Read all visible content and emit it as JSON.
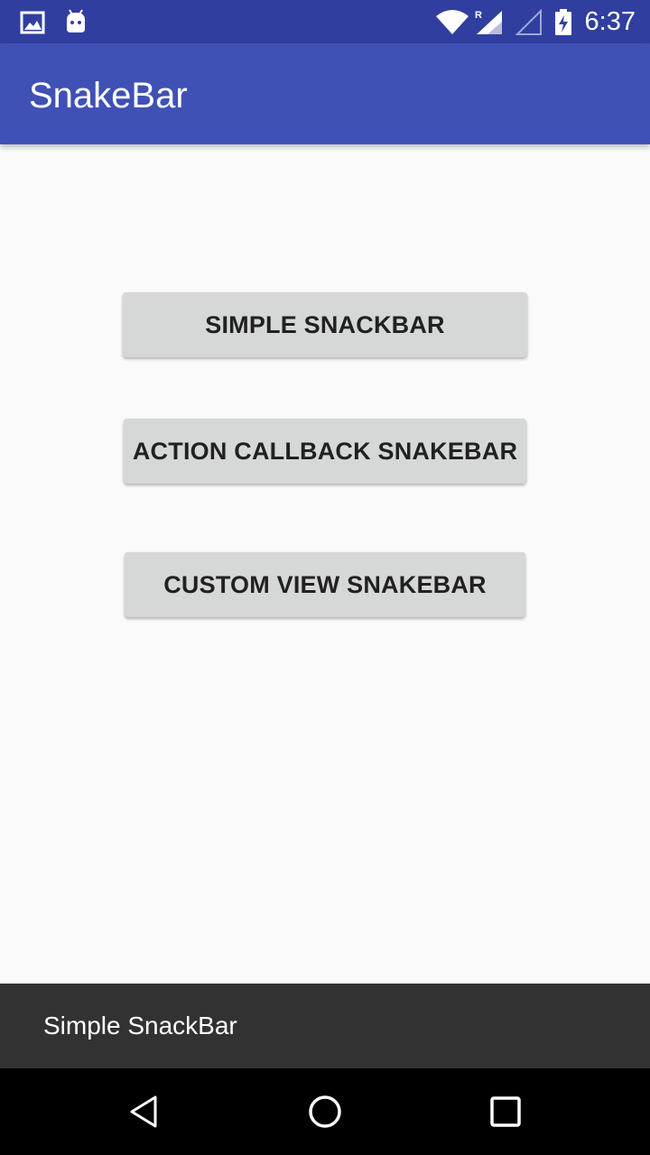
{
  "status_bar": {
    "time": "6:37",
    "left_icons": [
      "image-icon",
      "android-icon"
    ],
    "right_icons": [
      "wifi-icon",
      "signal-roaming-icon",
      "signal-empty-icon",
      "battery-charging-icon"
    ],
    "background": "#303f9f"
  },
  "app_bar": {
    "title": "SnakeBar",
    "background": "#3f51b5"
  },
  "buttons": [
    {
      "label": "SIMPLE SNACKBAR"
    },
    {
      "label": "ACTION CALLBACK SNAKEBAR"
    },
    {
      "label": "CUSTOM VIEW SNAKEBAR"
    }
  ],
  "snackbar": {
    "message": "Simple SnackBar",
    "background": "#323232"
  },
  "nav_bar": {
    "icons": [
      "back-icon",
      "home-icon",
      "recents-icon"
    ]
  }
}
